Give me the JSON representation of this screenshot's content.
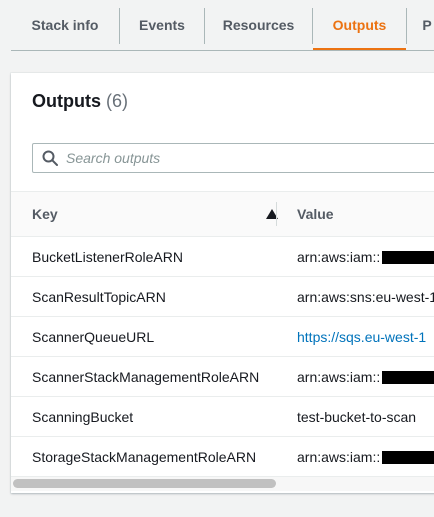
{
  "tabs": [
    {
      "label": "Stack info",
      "active": false
    },
    {
      "label": "Events",
      "active": false
    },
    {
      "label": "Resources",
      "active": false
    },
    {
      "label": "Outputs",
      "active": true
    },
    {
      "label": "P",
      "active": false
    }
  ],
  "panel": {
    "title": "Outputs",
    "count": "(6)"
  },
  "search": {
    "placeholder": "Search outputs",
    "value": ""
  },
  "table": {
    "columns": [
      "Key",
      "Value"
    ],
    "sort": {
      "column": "Key",
      "direction": "ascending"
    },
    "rows": [
      {
        "key": "BucketListenerRoleARN",
        "value": "arn:aws:iam::",
        "redacted": true,
        "link": false
      },
      {
        "key": "ScanResultTopicARN",
        "value": "arn:aws:sns:eu-west-1",
        "redacted": false,
        "link": false
      },
      {
        "key": "ScannerQueueURL",
        "value": "https://sqs.eu-west-1",
        "redacted": false,
        "link": true
      },
      {
        "key": "ScannerStackManagementRoleARN",
        "value": "arn:aws:iam::",
        "redacted": true,
        "link": false
      },
      {
        "key": "ScanningBucket",
        "value": "test-bucket-to-scan",
        "redacted": false,
        "link": false
      },
      {
        "key": "StorageStackManagementRoleARN",
        "value": "arn:aws:iam::",
        "redacted": true,
        "link": false
      }
    ]
  },
  "colors": {
    "accent": "#ec7211",
    "link": "#0073bb",
    "background": "#f2f3f3"
  },
  "icons": {
    "search": "search-icon",
    "sort": "sort-ascending-icon"
  }
}
